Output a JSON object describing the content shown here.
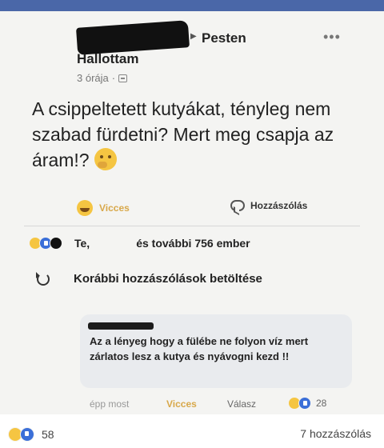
{
  "post": {
    "page_name": "Pesten",
    "author": "Hallottam",
    "time": "3 órája",
    "text": "A csippeltetett kutyákat, tényleg nem szabad fürdetni? Mert meg csapja az áram!?"
  },
  "actions": {
    "react_label": "Vicces",
    "comment_label": "Hozzászólás"
  },
  "reactions": {
    "you": "Te,",
    "others": "és további 756 ember"
  },
  "load_more": "Korábbi hozzászólások betöltése",
  "comment": {
    "text": "Az a lényeg hogy a fülébe ne folyon víz mert zárlatos lesz a kutya és nyávogni kezd !!",
    "time": "épp most",
    "react_label": "Vicces",
    "reply_label": "Válasz",
    "reaction_count": "28"
  },
  "footer": {
    "reaction_count": "58",
    "comment_count": "7 hozzászólás"
  },
  "colors": {
    "facebook_blue": "#4a67a8",
    "haha_yellow": "#f5c542",
    "like_blue": "#3b6fd8"
  },
  "icons": [
    "more-icon",
    "globe-icon",
    "thinking-emoji-icon",
    "haha-icon",
    "comment-icon",
    "like-icon",
    "reload-icon"
  ]
}
